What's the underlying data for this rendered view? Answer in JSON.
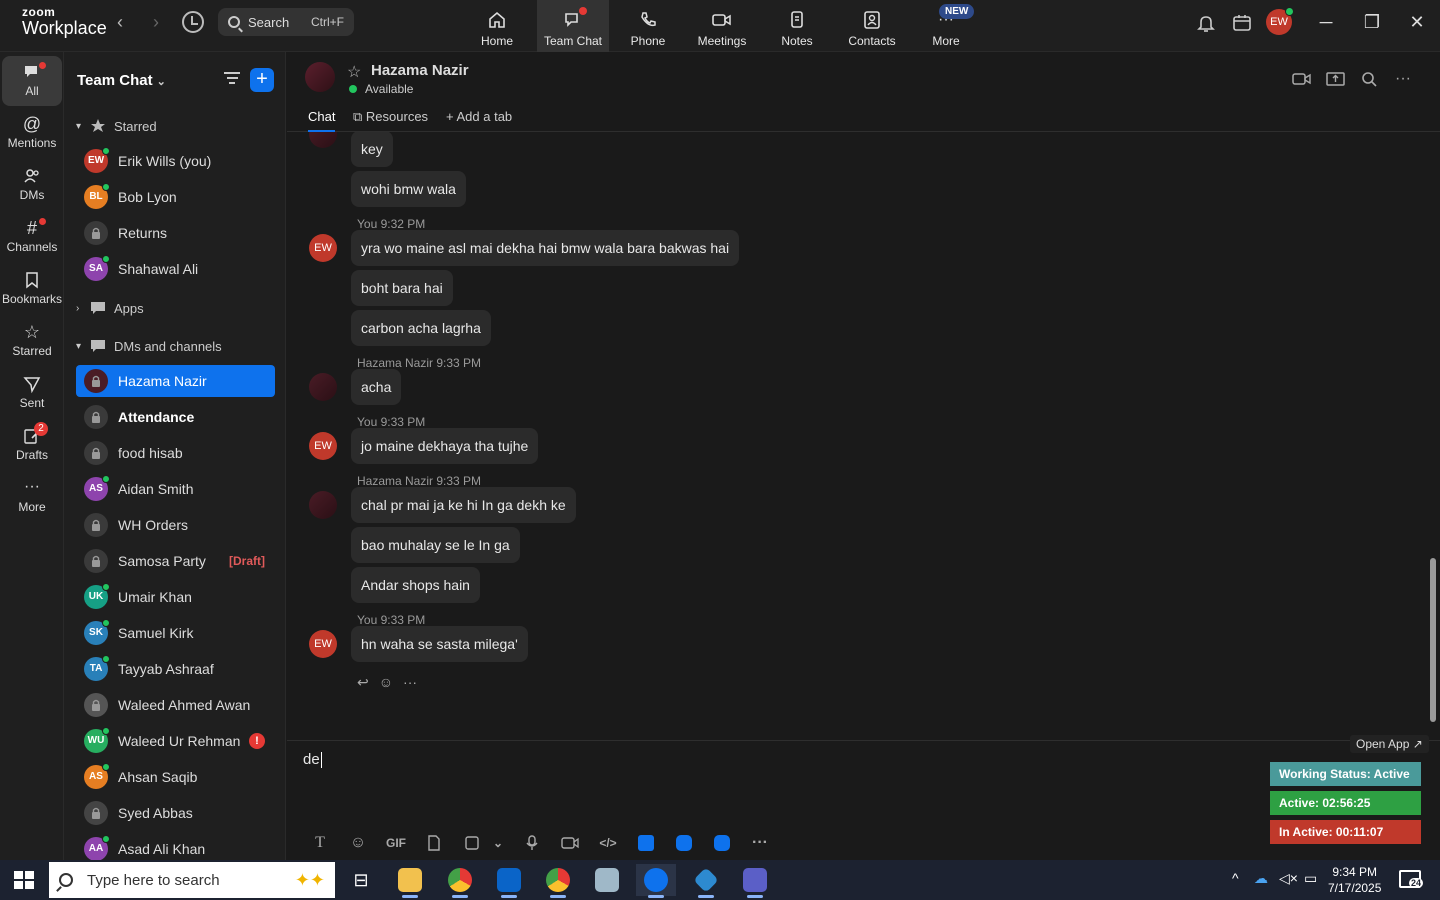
{
  "app": {
    "brand_top": "zoom",
    "brand_bottom": "Workplace"
  },
  "search": {
    "label": "Search",
    "shortcut": "Ctrl+F"
  },
  "nav_tabs": [
    {
      "label": "Home"
    },
    {
      "label": "Team Chat"
    },
    {
      "label": "Phone"
    },
    {
      "label": "Meetings"
    },
    {
      "label": "Notes"
    },
    {
      "label": "Contacts"
    },
    {
      "label": "More"
    }
  ],
  "new_badge": "NEW",
  "user_initials": "EW",
  "rail": [
    {
      "label": "All"
    },
    {
      "label": "Mentions"
    },
    {
      "label": "DMs"
    },
    {
      "label": "Channels"
    },
    {
      "label": "Bookmarks"
    },
    {
      "label": "Starred"
    },
    {
      "label": "Sent"
    },
    {
      "label": "Drafts",
      "count": "2"
    },
    {
      "label": "More"
    }
  ],
  "sidebar": {
    "title": "Team Chat",
    "sections": {
      "starred": "Starred",
      "apps": "Apps",
      "dms": "DMs and channels"
    },
    "starred": [
      {
        "name": "Erik Wills (you)",
        "initials": "EW",
        "color": "#c0392b"
      },
      {
        "name": "Bob Lyon",
        "initials": "BL",
        "color": "#e67e22"
      },
      {
        "name": "Returns",
        "initials": "",
        "color": "#3a3a3a"
      },
      {
        "name": "Shahawal Ali",
        "initials": "SA",
        "color": "#8e44ad"
      }
    ],
    "dms": [
      {
        "name": "Hazama Nazir",
        "initials": "",
        "color": "#4a1c26"
      },
      {
        "name": "Attendance",
        "initials": "",
        "color": "#3a3a3a"
      },
      {
        "name": "food hisab",
        "initials": "",
        "color": "#3a3a3a"
      },
      {
        "name": "Aidan Smith",
        "initials": "AS",
        "color": "#8e44ad"
      },
      {
        "name": "WH Orders",
        "initials": "",
        "color": "#3a3a3a"
      },
      {
        "name": "Samosa Party",
        "initials": "",
        "color": "#3a3a3a",
        "draft": "[Draft]"
      },
      {
        "name": "Umair Khan",
        "initials": "UK",
        "color": "#16a085"
      },
      {
        "name": "Samuel Kirk",
        "initials": "SK",
        "color": "#2980b9"
      },
      {
        "name": "Tayyab Ashraaf",
        "initials": "TA",
        "color": "#2980b9"
      },
      {
        "name": "Waleed Ahmed Awan",
        "initials": "",
        "color": "#555"
      },
      {
        "name": "Waleed Ur Rehman",
        "initials": "WU",
        "color": "#27ae60",
        "alert": "!"
      },
      {
        "name": "Ahsan Saqib",
        "initials": "AS",
        "color": "#e67e22"
      },
      {
        "name": "Syed Abbas",
        "initials": "",
        "color": "#444"
      },
      {
        "name": "Asad Ali Khan",
        "initials": "AA",
        "color": "#8e44ad"
      }
    ]
  },
  "chat": {
    "name": "Hazama Nazir",
    "status": "Available",
    "tabs": {
      "chat": "Chat",
      "resources": "Resources",
      "add": "Add a tab"
    },
    "messages": [
      {
        "sender": "hz",
        "meta": "",
        "text": "key"
      },
      {
        "sender": "",
        "meta": "",
        "text": "wohi bmw wala"
      },
      {
        "sender": "ew",
        "meta": "You 9:32 PM",
        "text": "yra wo maine asl mai dekha hai bmw wala bara bakwas hai"
      },
      {
        "sender": "",
        "meta": "",
        "text": "boht bara hai"
      },
      {
        "sender": "",
        "meta": "",
        "text": "carbon acha lagrha"
      },
      {
        "sender": "hz",
        "meta": "Hazama Nazir 9:33 PM",
        "text": "acha"
      },
      {
        "sender": "ew",
        "meta": "You 9:33 PM",
        "text": "jo maine dekhaya tha tujhe"
      },
      {
        "sender": "hz",
        "meta": "Hazama Nazir 9:33 PM",
        "text": "chal pr mai ja ke hi In ga dekh ke"
      },
      {
        "sender": "",
        "meta": "",
        "text": "bao muhalay se le In ga"
      },
      {
        "sender": "",
        "meta": "",
        "text": "Andar shops hain"
      },
      {
        "sender": "ew",
        "meta": "You 9:33 PM",
        "text": "hn waha se sasta milega'"
      }
    ]
  },
  "composer": {
    "text": "de"
  },
  "composer_toolbar": {
    "gif": "GIF"
  },
  "widget": {
    "open_app": "Open App ↗",
    "working": "Working Status: Active",
    "active": "Active: 02:56:25",
    "inactive": "In Active: 00:11:07"
  },
  "taskbar": {
    "search_placeholder": "Type here to search",
    "time": "9:34 PM",
    "date": "7/17/2025",
    "notif_count": "24"
  }
}
